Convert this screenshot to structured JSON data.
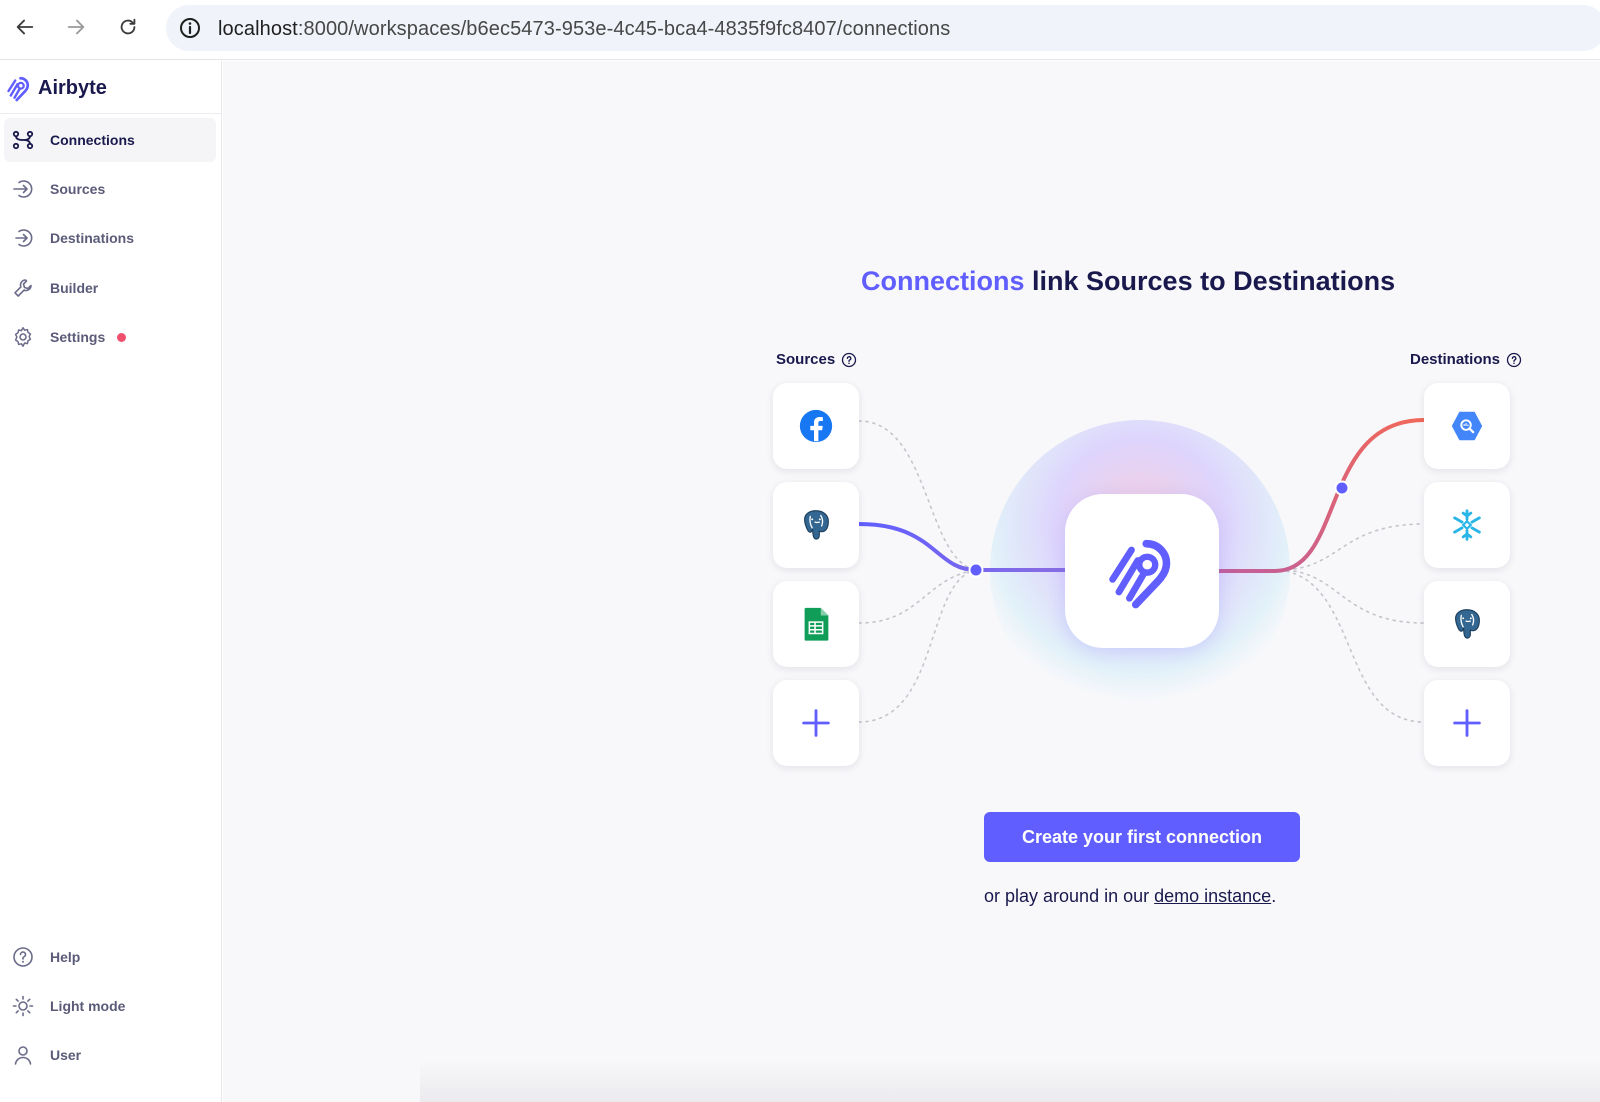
{
  "browser": {
    "url_host": "localhost",
    "url_path": ":8000/workspaces/b6ec5473-953e-4c45-bca4-4835f9fc8407/connections",
    "icons": [
      "back-arrow-icon",
      "forward-arrow-icon",
      "reload-icon",
      "info-icon"
    ]
  },
  "sidebar": {
    "brand": "Airbyte",
    "items": [
      {
        "label": "Connections",
        "icon": "connections-icon",
        "active": true
      },
      {
        "label": "Sources",
        "icon": "source-arrow-icon"
      },
      {
        "label": "Destinations",
        "icon": "destination-arrow-icon"
      },
      {
        "label": "Builder",
        "icon": "wrench-icon"
      },
      {
        "label": "Settings",
        "icon": "gear-icon",
        "badge": true
      }
    ],
    "bottom_items": [
      {
        "label": "Help",
        "icon": "help-icon"
      },
      {
        "label": "Light mode",
        "icon": "sun-icon"
      },
      {
        "label": "User",
        "icon": "user-icon"
      }
    ]
  },
  "main": {
    "headline_accent": "Connections",
    "headline_rest": " link Sources to Destinations",
    "sources_label": "Sources",
    "destinations_label": "Destinations",
    "source_tiles": [
      "facebook-icon",
      "postgres-icon",
      "google-sheets-icon",
      "plus-icon"
    ],
    "destination_tiles": [
      "bigquery-icon",
      "snowflake-icon",
      "postgres-icon",
      "plus-icon"
    ],
    "cta_label": "Create your first connection",
    "demo_prefix": "or play around in our ",
    "demo_link": "demo instance",
    "demo_suffix": "."
  },
  "colors": {
    "accent": "#615eff",
    "destination_line": "#f0685a",
    "badge": "#f0506e",
    "text": "#1a194d"
  }
}
